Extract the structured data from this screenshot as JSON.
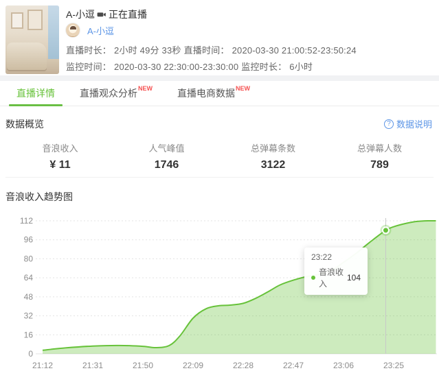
{
  "header": {
    "streamer_title": "A-小逗",
    "live_status": "正在直播",
    "streamer_name": "A-小逗",
    "info": {
      "duration_label": "直播时长：",
      "duration_value": "2小时 49分 33秒",
      "live_time_label": "直播时间：",
      "live_time_value": "2020-03-30 21:00:52-23:50:24",
      "monitor_time_label": "监控时间：",
      "monitor_time_value": "2020-03-30 22:30:00-23:30:00",
      "monitor_duration_label": "监控时长：",
      "monitor_duration_value": "6小时"
    },
    "icons": {
      "live": "video-camera-icon"
    }
  },
  "tabs": [
    {
      "label": "直播详情",
      "active": true,
      "badge": ""
    },
    {
      "label": "直播观众分析",
      "active": false,
      "badge": "NEW"
    },
    {
      "label": "直播电商数据",
      "active": false,
      "badge": "NEW"
    }
  ],
  "overview": {
    "section_title": "数据概览",
    "help_link_label": "数据说明",
    "help_icon": "question-circle-icon",
    "stats": [
      {
        "label": "音浪收入",
        "value": "¥ 11"
      },
      {
        "label": "人气峰值",
        "value": "1746"
      },
      {
        "label": "总弹幕条数",
        "value": "3122"
      },
      {
        "label": "总弹幕人数",
        "value": "789"
      }
    ]
  },
  "chart_section": {
    "title": "音浪收入趋势图"
  },
  "chart_data": {
    "type": "area",
    "title": "音浪收入趋势图",
    "series_name": "音浪收入",
    "x_ticks": [
      "21:12",
      "21:31",
      "21:50",
      "22:09",
      "22:28",
      "22:47",
      "23:06",
      "23:25"
    ],
    "y_ticks": [
      0,
      16,
      32,
      48,
      64,
      80,
      96,
      112
    ],
    "ylim": [
      0,
      112
    ],
    "grid": "dotted-horizontal",
    "legend_position": "none",
    "points": [
      [
        "21:12",
        3
      ],
      [
        "21:21",
        5
      ],
      [
        "21:31",
        6.5
      ],
      [
        "21:41",
        7
      ],
      [
        "21:50",
        6.3
      ],
      [
        "21:55",
        5.2
      ],
      [
        "22:00",
        7
      ],
      [
        "22:04",
        15
      ],
      [
        "22:09",
        30
      ],
      [
        "22:14",
        38
      ],
      [
        "22:19",
        40.5
      ],
      [
        "22:23",
        41
      ],
      [
        "22:28",
        42.5
      ],
      [
        "22:33",
        47
      ],
      [
        "22:38",
        53
      ],
      [
        "22:42",
        58
      ],
      [
        "22:47",
        62
      ],
      [
        "22:52",
        65
      ],
      [
        "22:57",
        67
      ],
      [
        "23:02",
        71
      ],
      [
        "23:06",
        77
      ],
      [
        "23:11",
        85
      ],
      [
        "23:16",
        94
      ],
      [
        "23:22",
        104
      ],
      [
        "23:25",
        107
      ],
      [
        "23:30",
        110
      ],
      [
        "23:34",
        111.5
      ],
      [
        "23:38",
        112
      ],
      [
        "23:41",
        112
      ]
    ],
    "tooltip": {
      "time": "23:22",
      "series": "音浪收入",
      "value": "104"
    },
    "line_color": "#67c23a",
    "fill_color": "rgba(103,194,58,0.33)"
  },
  "colors": {
    "accent_green": "#67c23a",
    "link_blue": "#5c95e6",
    "badge_red": "#f55050"
  }
}
